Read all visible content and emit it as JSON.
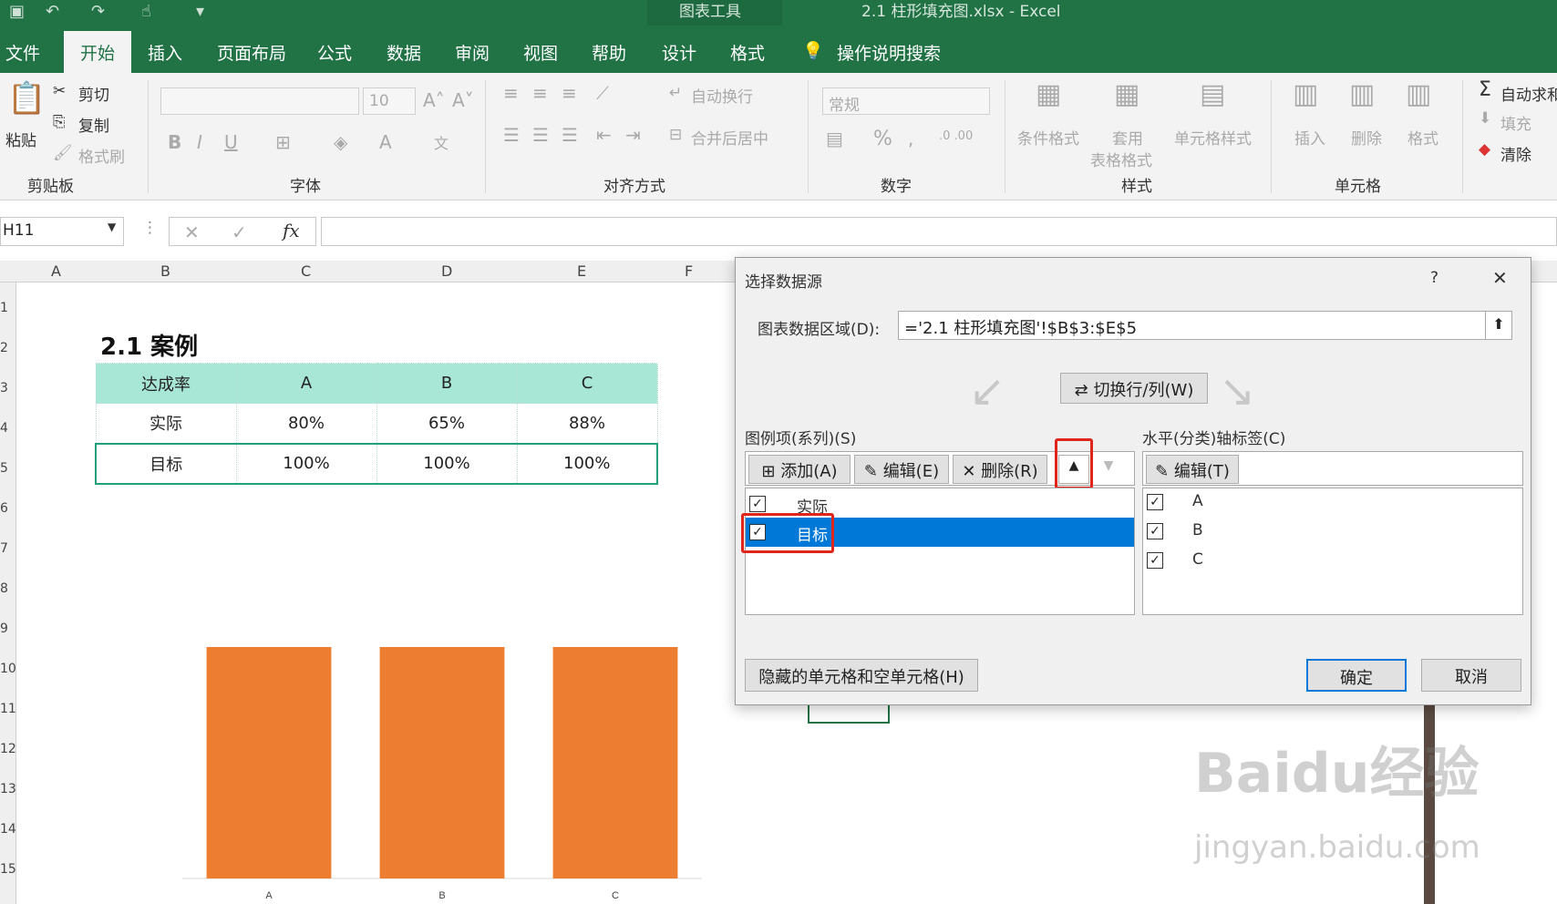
{
  "window": {
    "context_tab_label": "图表工具",
    "document_title": "2.1 柱形填充图.xlsx  -  Excel"
  },
  "tabs": [
    "文件",
    "开始",
    "插入",
    "页面布局",
    "公式",
    "数据",
    "审阅",
    "视图",
    "帮助",
    "设计",
    "格式"
  ],
  "active_tab": "开始",
  "search_label": "操作说明搜索",
  "ribbon": {
    "clipboard": {
      "paste": "粘贴",
      "cut": "剪切",
      "copy": "复制",
      "painter": "格式刷",
      "group": "剪贴板"
    },
    "font": {
      "size": "10",
      "group": "字体"
    },
    "align": {
      "wrap": "自动换行",
      "merge": "合并后居中",
      "group": "对齐方式"
    },
    "number": {
      "format": "常规",
      "percent": "%",
      "group": "数字"
    },
    "styles": {
      "cond": "条件格式",
      "table1": "套用",
      "table2": "表格格式",
      "cell": "单元格样式",
      "group": "样式"
    },
    "cells": {
      "insert": "插入",
      "delete": "删除",
      "format": "格式",
      "group": "单元格"
    },
    "editing": {
      "autosum": "自动求和",
      "fill": "填充",
      "clear": "清除"
    }
  },
  "formula_bar": {
    "name_box": "H11",
    "fx": "fx"
  },
  "columns": [
    "A",
    "B",
    "C",
    "D",
    "E",
    "F"
  ],
  "rows": [
    "1",
    "2",
    "3",
    "4",
    "5",
    "6",
    "7",
    "8",
    "9",
    "10",
    "11",
    "12",
    "13",
    "14",
    "15"
  ],
  "sheet": {
    "heading": "2.1 案例",
    "table": {
      "header": [
        "达成率",
        "A",
        "B",
        "C"
      ],
      "rows": [
        [
          "实际",
          "80%",
          "65%",
          "88%"
        ],
        [
          "目标",
          "100%",
          "100%",
          "100%"
        ]
      ]
    }
  },
  "chart_data": {
    "type": "bar",
    "categories": [
      "A",
      "B",
      "C"
    ],
    "series": [
      {
        "values": [
          1.0,
          1.0,
          1.0
        ],
        "color": "#ed7d31"
      }
    ],
    "ylim": [
      0,
      1.0
    ],
    "title": "",
    "xlabel": "",
    "ylabel": ""
  },
  "dialog": {
    "title": "选择数据源",
    "help": "?",
    "close": "✕",
    "range_label": "图表数据区域(D):",
    "range_value": "='2.1 柱形填充图'!$B$3:$E$5",
    "switch_button": "切换行/列(W)",
    "legend_label": "图例项(系列)(S)",
    "add_button": "添加(A)",
    "edit_button": "编辑(E)",
    "delete_button": "删除(R)",
    "series": [
      {
        "name": "实际",
        "checked": true,
        "selected": false
      },
      {
        "name": "目标",
        "checked": true,
        "selected": true
      }
    ],
    "axis_label": "水平(分类)轴标签(C)",
    "axis_edit_button": "编辑(T)",
    "categories": [
      {
        "name": "A",
        "checked": true
      },
      {
        "name": "B",
        "checked": true
      },
      {
        "name": "C",
        "checked": true
      }
    ],
    "hidden_cells_button": "隐藏的单元格和空单元格(H)",
    "ok_button": "确定",
    "cancel_button": "取消"
  },
  "watermark": {
    "line1": "Baidu经验",
    "line2": "jingyan.baidu.com"
  },
  "colors": {
    "excel_green": "#217346",
    "bar": "#ed7d31",
    "highlight": "#e0261a",
    "selection": "#0078d7",
    "header_fill": "#a8e6d6"
  }
}
